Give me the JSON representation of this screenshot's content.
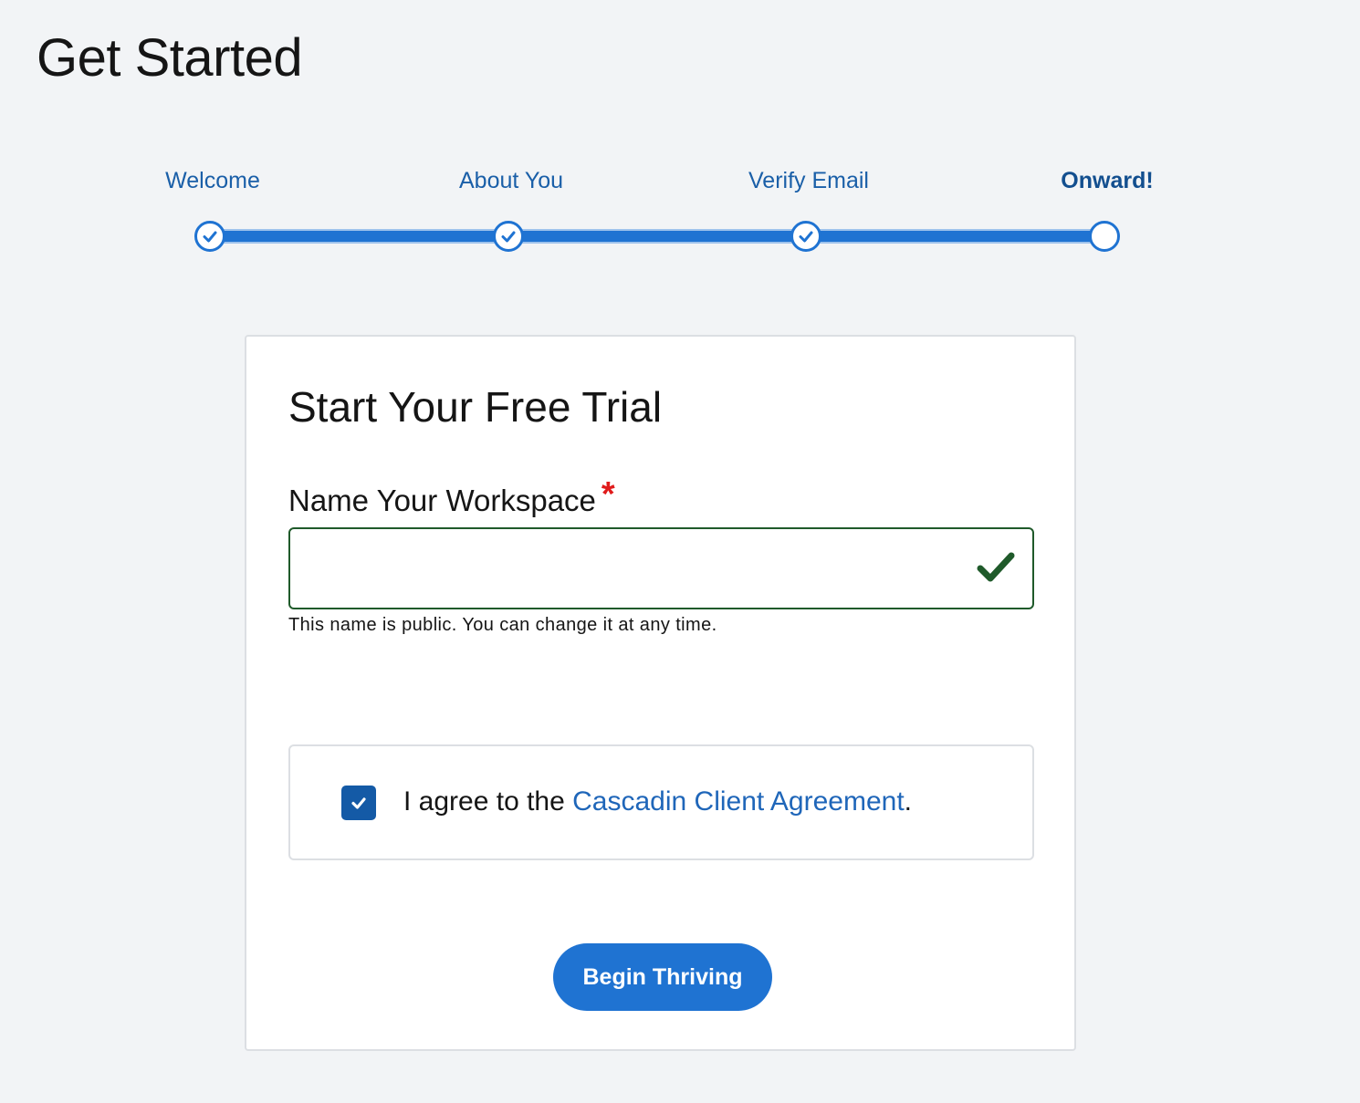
{
  "page": {
    "title": "Get Started"
  },
  "stepper": {
    "steps": [
      {
        "label": "Welcome",
        "state": "complete",
        "icon": "check-icon"
      },
      {
        "label": "About You",
        "state": "complete",
        "icon": "check-icon"
      },
      {
        "label": "Verify Email",
        "state": "complete",
        "icon": "check-icon"
      },
      {
        "label": "Onward!",
        "state": "current",
        "icon": "empty-circle-icon"
      }
    ],
    "accent_color": "#1f73d2"
  },
  "card": {
    "title": "Start Your Free Trial",
    "workspace_field": {
      "label": "Name Your Workspace",
      "required_marker": "*",
      "value": "",
      "placeholder": "",
      "status_icon": "checkmark-icon",
      "hint": "This name is public. You can change it at any time."
    },
    "agreement": {
      "checked": true,
      "prefix": "I agree to the ",
      "link_text": "Cascadin Client Agreement",
      "suffix": "."
    },
    "submit_label": "Begin Thriving"
  },
  "colors": {
    "background": "#f2f4f6",
    "link": "#1f66b9",
    "required": "#e01b1b",
    "valid": "#1f5a2a",
    "button": "#1f73d2"
  }
}
